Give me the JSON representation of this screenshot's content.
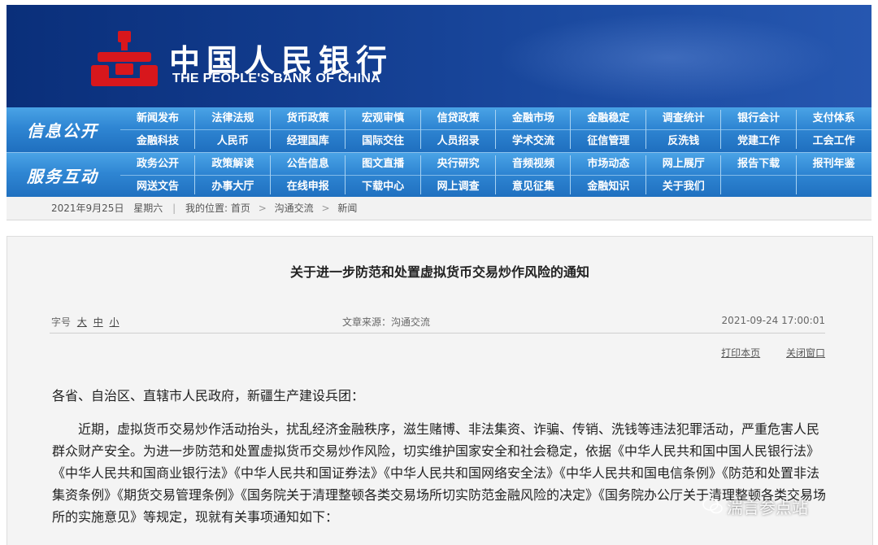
{
  "header": {
    "bank_name_cn": "中国人民银行",
    "bank_name_en": "THE PEOPLE'S BANK OF CHINA",
    "logo_icon": "pboc-logo-icon",
    "colors": {
      "banner": "#123c8e",
      "nav": "#2f86d3",
      "logo_red": "#d8171c"
    }
  },
  "nav": {
    "section1_label": "信息公开",
    "section2_label": "服务互动",
    "row1": [
      "新闻发布",
      "法律法规",
      "货币政策",
      "宏观审慎",
      "信贷政策",
      "金融市场",
      "金融稳定",
      "调查统计",
      "银行会计",
      "支付体系"
    ],
    "row2": [
      "金融科技",
      "人民币",
      "经理国库",
      "国际交往",
      "人员招录",
      "学术交流",
      "征信管理",
      "反洗钱",
      "党建工作",
      "工会工作"
    ],
    "row3": [
      "政务公开",
      "政策解读",
      "公告信息",
      "图文直播",
      "央行研究",
      "音频视频",
      "市场动态",
      "网上展厅",
      "报告下载",
      "报刊年鉴"
    ],
    "row4": [
      "网送文告",
      "办事大厅",
      "在线申报",
      "下载中心",
      "网上调查",
      "意见征集",
      "金融知识",
      "关于我们"
    ]
  },
  "breadcrumb": {
    "date": "2021年9月25日",
    "weekday": "星期六",
    "sep": "|",
    "location_label": "我的位置:",
    "home": "首页",
    "arrow": ">",
    "level1": "沟通交流",
    "level2": "新闻"
  },
  "article": {
    "title": "关于进一步防范和处置虚拟货币交易炒作风险的通知",
    "font_size_label": "字号",
    "font_large": "大",
    "font_medium": "中",
    "font_small": "小",
    "source": "文章来源：沟通交流",
    "datetime": "2021-09-24 17:00:01",
    "print_label": "打印本页",
    "close_label": "关闭窗口",
    "greeting": "各省、自治区、直辖市人民政府，新疆生产建设兵团：",
    "paragraph": "近期，虚拟货币交易炒作活动抬头，扰乱经济金融秩序，滋生赌博、非法集资、诈骗、传销、洗钱等违法犯罪活动，严重危害人民群众财产安全。为进一步防范和处置虚拟货币交易炒作风险，切实维护国家安全和社会稳定，依据《中华人民共和国中国人民银行法》《中华人民共和国商业银行法》《中华人民共和国证券法》《中华人民共和国网络安全法》《中华人民共和国电信条例》《防范和处置非法集资条例》《期货交易管理条例》《国务院关于清理整顿各类交易场所切实防范金融风险的决定》《国务院办公厅关于清理整顿各类交易场所的实施意见》等规定，现就有关事项通知如下："
  },
  "watermark": {
    "text": "湍言参点站",
    "icon": "wechat-icon"
  }
}
